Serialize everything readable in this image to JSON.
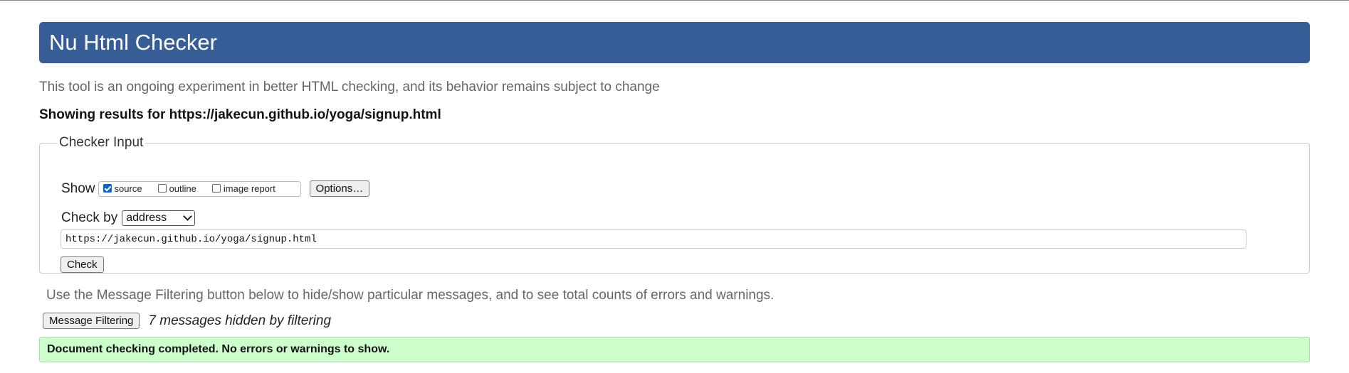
{
  "header": {
    "title": "Nu Html Checker"
  },
  "intro": "This tool is an ongoing experiment in better HTML checking, and its behavior remains subject to change",
  "results_heading": "Showing results for https://jakecun.github.io/yoga/signup.html",
  "checker_input": {
    "legend": "Checker Input",
    "show_label": "Show",
    "show_options": [
      {
        "label": "source",
        "checked": true
      },
      {
        "label": "outline",
        "checked": false
      },
      {
        "label": "image report",
        "checked": false
      }
    ],
    "options_button": "Options…",
    "check_by_label": "Check by",
    "check_by_selected": "address",
    "url_value": "https://jakecun.github.io/yoga/signup.html",
    "check_button": "Check"
  },
  "filtering": {
    "note": "Use the Message Filtering button below to hide/show particular messages, and to see total counts of errors and warnings.",
    "button": "Message Filtering",
    "hidden_count": "7 messages hidden by filtering"
  },
  "status": {
    "message": "Document checking completed. No errors or warnings to show.",
    "color": "#ccffcc"
  },
  "colors": {
    "header_bg": "#365d95"
  }
}
